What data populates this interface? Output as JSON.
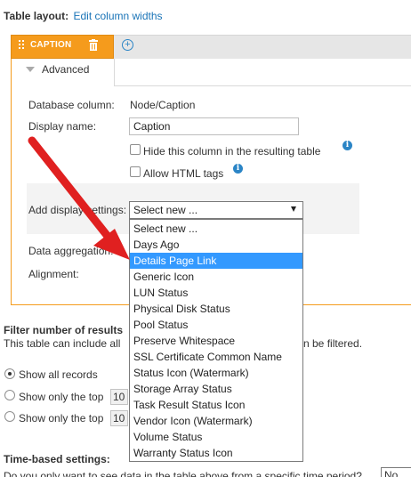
{
  "header": {
    "title": "Table layout:",
    "edit_link": "Edit column widths"
  },
  "column": {
    "tab_label": "CAPTION",
    "advanced_label": "Advanced"
  },
  "form": {
    "db_column_label": "Database column:",
    "db_column_value": "Node/Caption",
    "display_name_label": "Display name:",
    "display_name_value": "Caption",
    "hide_label": "Hide this column in the resulting table",
    "html_label": "Allow HTML tags",
    "add_display_label": "Add display settings:",
    "add_display_value": "Select new ...",
    "data_agg_label": "Data aggregation:",
    "alignment_label": "Alignment:"
  },
  "dropdown": {
    "options": [
      "Select new ...",
      "Days Ago",
      "Details Page Link",
      "Generic Icon",
      "LUN Status",
      "Physical Disk Status",
      "Pool Status",
      "Preserve Whitespace",
      "SSL Certificate Common Name",
      "Status Icon (Watermark)",
      "Storage Array Status",
      "Task Result Status Icon",
      "Vendor Icon (Watermark)",
      "Volume Status",
      "Warranty Status Icon"
    ],
    "selected": "Details Page Link"
  },
  "filter": {
    "heading": "Filter number of results",
    "desc": "This table can include all",
    "desc_tail": "n be filtered.",
    "radio_all": "Show all records",
    "radio_top1": "Show only the top",
    "radio_top2": "Show only the top",
    "top1_value": "10",
    "top2_value": "10"
  },
  "time": {
    "heading": "Time-based settings:",
    "desc": "Do you only want to see data in the table above from a specific time period?",
    "select_value": "No"
  },
  "colors": {
    "accent_orange": "#f59b1c",
    "link_blue": "#1a74b7",
    "selection_blue": "#3399ff",
    "arrow_red": "#e02020"
  }
}
